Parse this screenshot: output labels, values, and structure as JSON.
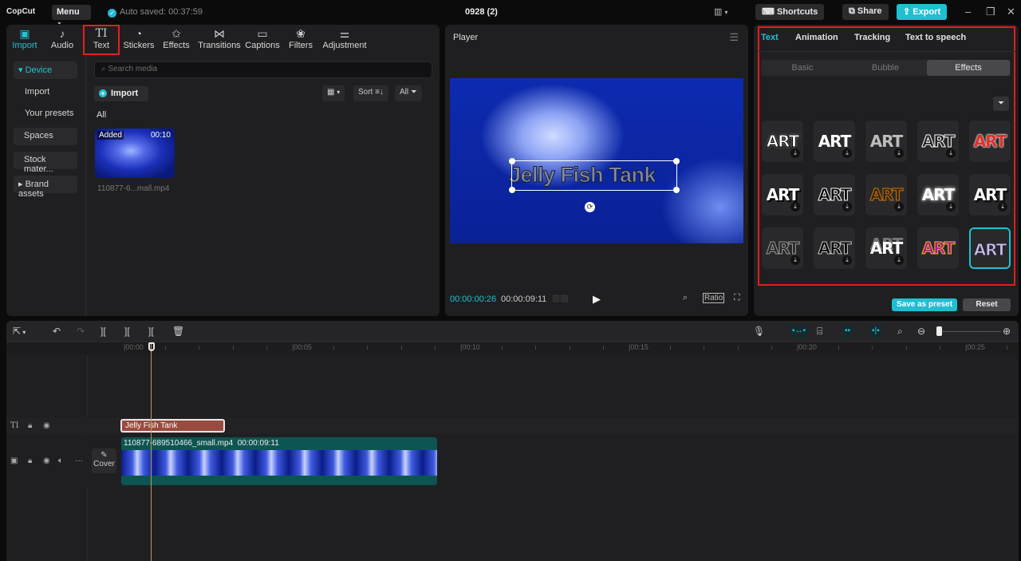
{
  "topbar": {
    "logo": "CopCut",
    "menu_label": "Menu",
    "autosave": "Auto saved: 00:37:59",
    "project_title": "0928 (2)",
    "shortcuts_label": "Shortcuts",
    "share_label": "Share",
    "export_label": "Export",
    "accent": "#1fbfd1"
  },
  "media_tabs": [
    {
      "label": "Import",
      "icon": "import-icon",
      "glyph": "▣"
    },
    {
      "label": "Audio",
      "icon": "audio-icon",
      "glyph": "♪"
    },
    {
      "label": "Text",
      "icon": "text-icon",
      "glyph": "TI"
    },
    {
      "label": "Stickers",
      "icon": "stickers-icon",
      "glyph": "◔"
    },
    {
      "label": "Effects",
      "icon": "effects-icon",
      "glyph": "✩"
    },
    {
      "label": "Transitions",
      "icon": "transitions-icon",
      "glyph": "⋈"
    },
    {
      "label": "Captions",
      "icon": "captions-icon",
      "glyph": "▭"
    },
    {
      "label": "Filters",
      "icon": "filters-icon",
      "glyph": "❀"
    },
    {
      "label": "Adjustment",
      "icon": "adjustment-icon",
      "glyph": "⚌"
    }
  ],
  "sidebar": {
    "items": [
      {
        "label": "▾ Device"
      },
      {
        "label": "Import"
      },
      {
        "label": "Your presets"
      },
      {
        "label": "Spaces"
      },
      {
        "label": "Stock mater..."
      },
      {
        "label": "▸ Brand assets"
      }
    ]
  },
  "media": {
    "search_placeholder": "Search media",
    "import_label": "Import",
    "sort_label": "Sort",
    "all_filter_label": "All",
    "section_label": "All",
    "items": [
      {
        "badge": "Added",
        "duration": "00:10",
        "name": "110877-6...mall.mp4"
      }
    ]
  },
  "player": {
    "title": "Player",
    "overlay_text": "Jelly Fish Tank",
    "current_time": "00:00:00:26",
    "total_time": "00:00:09:11",
    "ratio_label": "Ratio"
  },
  "inspector": {
    "tabs": [
      "Text",
      "Animation",
      "Tracking",
      "Text to speech"
    ],
    "active_tab": "Text",
    "segments": [
      "Basic",
      "Bubble",
      "Effects"
    ],
    "active_segment": "Effects",
    "effect_label": "ART",
    "effects": [
      {
        "style": "outline-white",
        "download": true
      },
      {
        "style": "plain-white",
        "download": true
      },
      {
        "style": "silver-gradient",
        "download": true
      },
      {
        "style": "double-outline",
        "download": true
      },
      {
        "style": "red-white-outline",
        "download": false
      },
      {
        "style": "shadow-white",
        "download": true
      },
      {
        "style": "black-outline",
        "download": true
      },
      {
        "style": "fire",
        "download": true
      },
      {
        "style": "glow-white",
        "download": true
      },
      {
        "style": "dark-shadow",
        "download": true
      },
      {
        "style": "hollow-grey",
        "download": true
      },
      {
        "style": "black-white-outline",
        "download": true
      },
      {
        "style": "echo-white",
        "download": true
      },
      {
        "style": "neon-pink",
        "download": false
      },
      {
        "style": "metal-purple",
        "download": false,
        "selected": true
      }
    ],
    "save_preset_label": "Save as preset",
    "reset_label": "Reset"
  },
  "timeline": {
    "ruler_labels": [
      "00:00",
      "00:05",
      "00:10",
      "00:15",
      "00:20",
      "00:25"
    ],
    "text_clip_label": "Jelly Fish Tank",
    "video_clip_name": "110877-689510466_small.mp4",
    "video_clip_duration": "00:00:09:11",
    "cover_label": "Cover",
    "zoom_level": 0.1
  }
}
